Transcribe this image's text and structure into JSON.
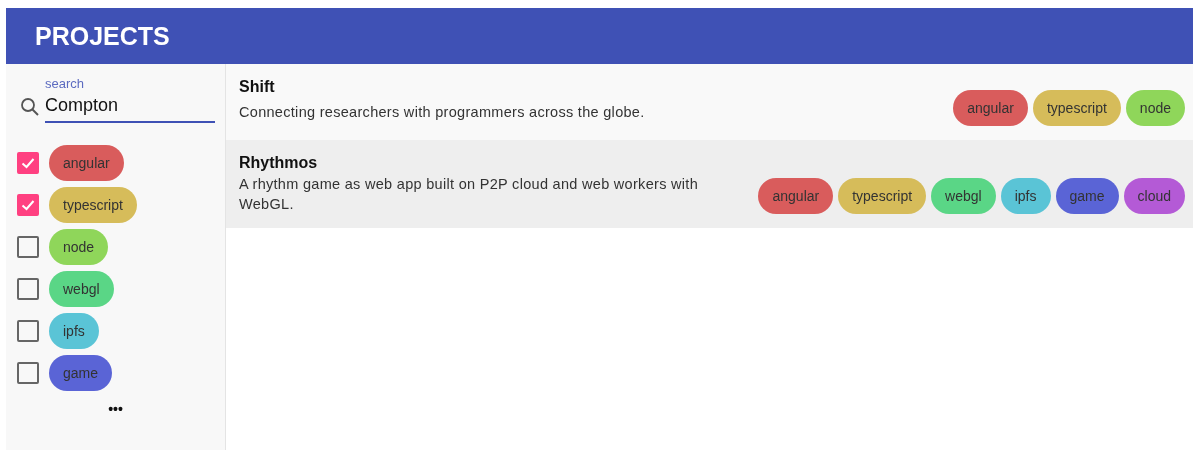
{
  "header": {
    "title": "PROJECTS"
  },
  "search": {
    "label": "search",
    "value": "Compton"
  },
  "filters": [
    {
      "label": "angular",
      "color": "#d95c5c",
      "checked": true
    },
    {
      "label": "typescript",
      "color": "#d6bc5a",
      "checked": true
    },
    {
      "label": "node",
      "color": "#8fd65a",
      "checked": false
    },
    {
      "label": "webgl",
      "color": "#5ad686",
      "checked": false
    },
    {
      "label": "ipfs",
      "color": "#5ac4d6",
      "checked": false
    },
    {
      "label": "game",
      "color": "#5a64d6",
      "checked": false
    }
  ],
  "more_label": "•••",
  "projects": [
    {
      "title": "Shift",
      "description": "Connecting researchers with programmers across the globe.",
      "tags": [
        {
          "label": "angular",
          "color": "#d95c5c"
        },
        {
          "label": "typescript",
          "color": "#d6bc5a"
        },
        {
          "label": "node",
          "color": "#8fd65a"
        }
      ]
    },
    {
      "title": "Rhythmos",
      "description": "A rhythm game as web app built on P2P cloud and web workers with WebGL.",
      "tags": [
        {
          "label": "angular",
          "color": "#d95c5c"
        },
        {
          "label": "typescript",
          "color": "#d6bc5a"
        },
        {
          "label": "webgl",
          "color": "#5ad686"
        },
        {
          "label": "ipfs",
          "color": "#5ac4d6"
        },
        {
          "label": "game",
          "color": "#5a64d6"
        },
        {
          "label": "cloud",
          "color": "#b45ad6"
        }
      ]
    }
  ]
}
